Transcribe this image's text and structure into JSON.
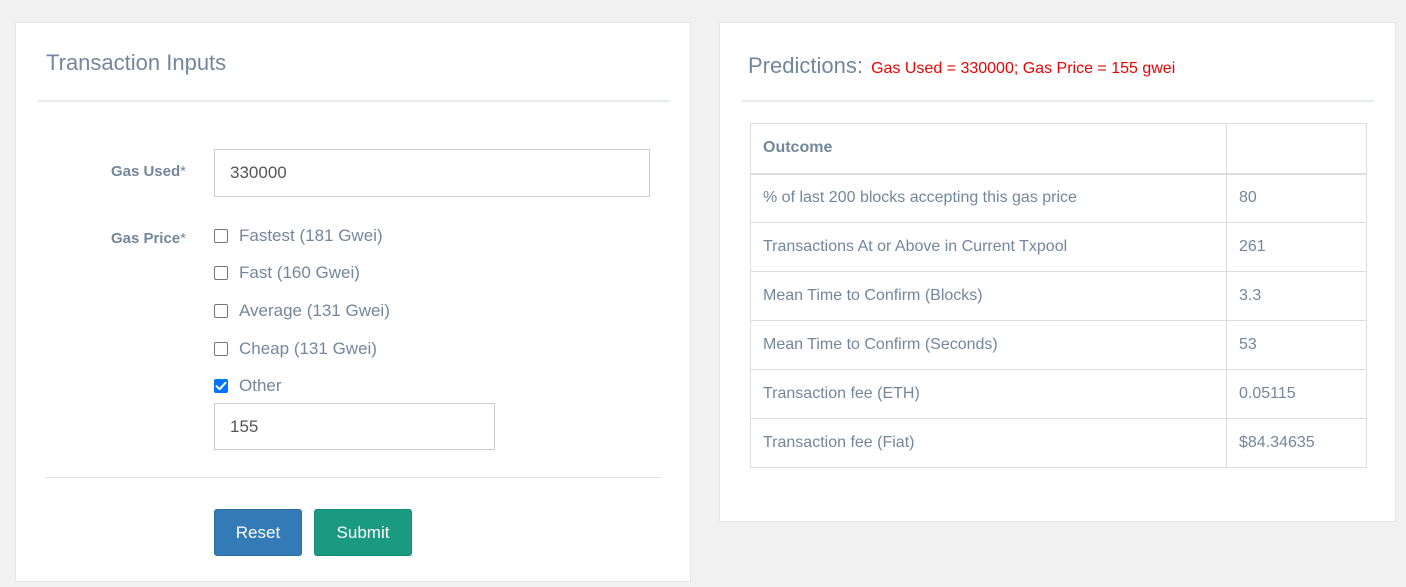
{
  "inputs": {
    "title": "Transaction Inputs",
    "gas_used_label": "Gas Used",
    "gas_used_value": "330000",
    "gas_price_label": "Gas Price",
    "required_mark": "*",
    "options": [
      {
        "label": "Fastest (181 Gwei)",
        "checked": false
      },
      {
        "label": "Fast (160 Gwei)",
        "checked": false
      },
      {
        "label": "Average (131 Gwei)",
        "checked": false
      },
      {
        "label": "Cheap (131 Gwei)",
        "checked": false
      },
      {
        "label": "Other",
        "checked": true
      }
    ],
    "other_value": "155",
    "reset_label": "Reset",
    "submit_label": "Submit"
  },
  "predictions": {
    "title": "Predictions:",
    "subtitle": "Gas Used = 330000; Gas Price = 155 gwei",
    "header": {
      "outcome": "Outcome",
      "value": ""
    },
    "rows": [
      {
        "label": "% of last 200 blocks accepting this gas price",
        "value": "80"
      },
      {
        "label": "Transactions At or Above in Current Txpool",
        "value": "261"
      },
      {
        "label": "Mean Time to Confirm (Blocks)",
        "value": "3.3"
      },
      {
        "label": "Mean Time to Confirm (Seconds)",
        "value": "53"
      },
      {
        "label": "Transaction fee (ETH)",
        "value": "0.05115"
      },
      {
        "label": "Transaction fee (Fiat)",
        "value": "$84.34635"
      }
    ]
  },
  "colors": {
    "reset_button": "#337ab7",
    "submit_button": "#1a9a80",
    "subtitle": "#f20000",
    "checkbox_checked": "#0075ff"
  }
}
